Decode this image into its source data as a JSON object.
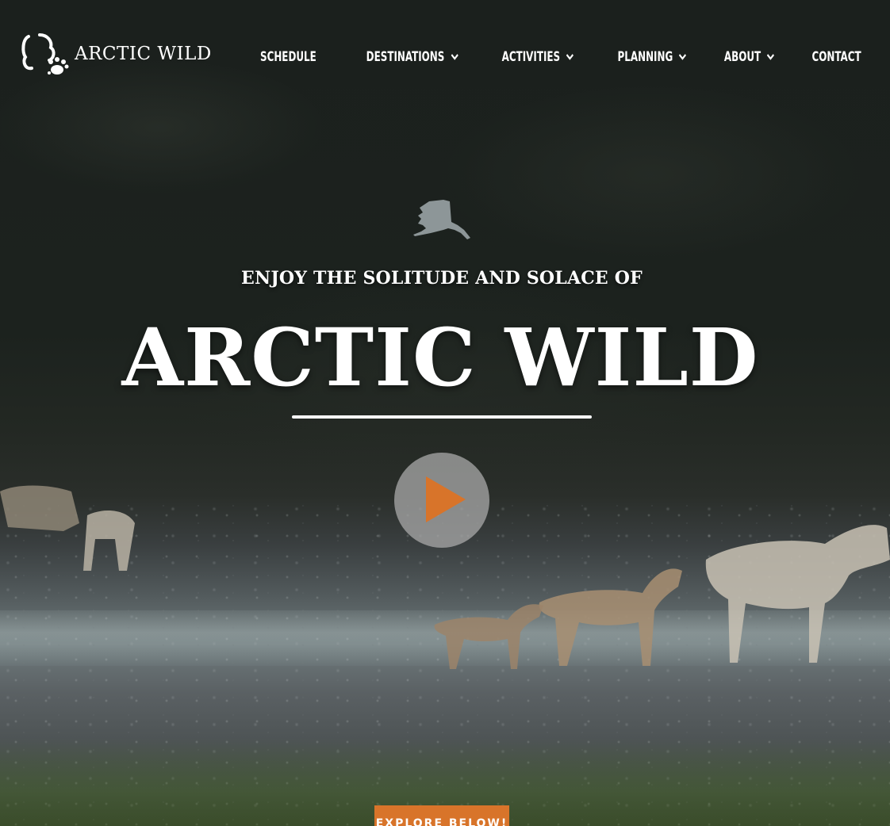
{
  "brand": {
    "name": "ARCTIC WILD",
    "logo_icon": "bear-paw-icon"
  },
  "nav": {
    "items": [
      {
        "label": "SCHEDULE",
        "dropdown": false
      },
      {
        "label": "DESTINATIONS",
        "dropdown": true
      },
      {
        "label": "ACTIVITIES",
        "dropdown": true
      },
      {
        "label": "PLANNING",
        "dropdown": true
      },
      {
        "label": "ABOUT",
        "dropdown": true
      },
      {
        "label": "CONTACT",
        "dropdown": false
      }
    ]
  },
  "hero": {
    "map_icon": "alaska-map-icon",
    "tagline": "ENJOY THE SOLITUDE AND SOLACE OF",
    "title": "ARCTIC WILD",
    "play_icon": "play-icon",
    "cta_label": "EXPLORE BELOW!"
  },
  "colors": {
    "accent": "#d8742a",
    "text": "#ffffff",
    "play_bg": "#aaaaaa"
  }
}
